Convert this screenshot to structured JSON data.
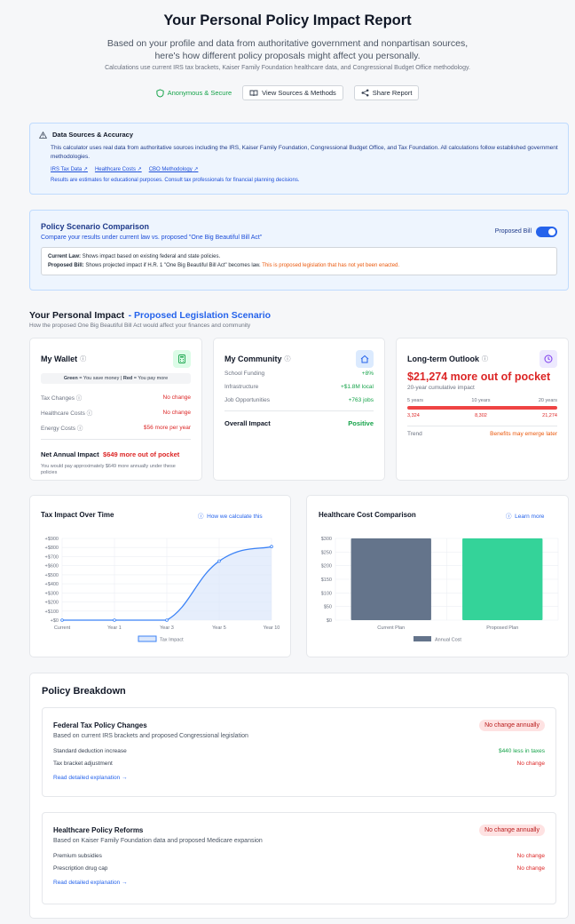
{
  "header": {
    "title": "Your Personal Policy Impact Report",
    "subtitle": "Based on your profile and data from authoritative government and nonpartisan sources, here's how different policy proposals might affect you personally.",
    "note": "Calculations use current IRS tax brackets, Kaiser Family Foundation healthcare data, and Congressional Budget Office methodology.",
    "secure_label": "Anonymous & Secure",
    "sources_button": "View Sources & Methods",
    "share_button": "Share Report"
  },
  "sources": {
    "title": "Data Sources & Accuracy",
    "body": "This calculator uses real data from authoritative sources including the IRS, Kaiser Family Foundation, Congressional Budget Office, and Tax Foundation. All calculations follow established government methodologies.",
    "links": [
      "IRS Tax Data",
      "Healthcare Costs",
      "CBO Methodology"
    ],
    "disclaimer": "Results are estimates for educational purposes. Consult tax professionals for financial planning decisions."
  },
  "scenario": {
    "title": "Policy Scenario Comparison",
    "subtitle": "Compare your results under current law vs. proposed \"One Big Beautiful Bill Act\"",
    "toggle_label": "Proposed Bill",
    "toggle_on": true,
    "current_law_label": "Current Law:",
    "current_law_text": "Shows impact based on existing federal and state policies.",
    "proposed_label": "Proposed Bill:",
    "proposed_text": "Shows projected impact if H.R. 1 \"One Big Beautiful Bill Act\" becomes law.",
    "proposed_warning": "This is proposed legislation that has not yet been enacted."
  },
  "impact": {
    "title": "Your Personal Impact",
    "title_highlight": "- Proposed Legislation Scenario",
    "subtitle": "How the proposed One Big Beautiful Bill Act would affect your finances and community"
  },
  "wallet": {
    "title": "My Wallet",
    "legend_green": "Green",
    "legend_green_text": "= You save money |",
    "legend_red": "Red",
    "legend_red_text": "= You pay more",
    "rows": [
      {
        "label": "Tax Changes",
        "value": "No change"
      },
      {
        "label": "Healthcare Costs",
        "value": "No change"
      },
      {
        "label": "Energy Costs",
        "value": "$56 more per year"
      }
    ],
    "net_label": "Net Annual Impact",
    "net_value": "$649 more out of pocket",
    "net_note": "You would pay approximately $649 more annually under these policies"
  },
  "community": {
    "title": "My Community",
    "rows": [
      {
        "label": "School Funding",
        "value": "+8%"
      },
      {
        "label": "Infrastructure",
        "value": "+$1.8M local"
      },
      {
        "label": "Job Opportunities",
        "value": "+763 jobs"
      }
    ],
    "overall_label": "Overall Impact",
    "overall_value": "Positive"
  },
  "outlook": {
    "title": "Long-term Outlook",
    "headline": "$21,274 more out of pocket",
    "sub": "20-year cumulative impact",
    "years": [
      "5 years",
      "10 years",
      "20 years"
    ],
    "values": [
      "3,324",
      "8,302",
      "21,274"
    ],
    "trend_label": "Trend",
    "trend_value": "Benefits may emerge later"
  },
  "tax_chart": {
    "title": "Tax Impact Over Time",
    "link": "How we calculate this",
    "legend": "Tax Impact"
  },
  "health_chart": {
    "title": "Healthcare Cost Comparison",
    "link": "Learn more",
    "legend": "Annual Cost"
  },
  "chart_data": [
    {
      "type": "area",
      "title": "Tax Impact Over Time",
      "x": [
        "Current",
        "Year 1",
        "Year 3",
        "Year 5",
        "Year 10"
      ],
      "series": [
        {
          "name": "Tax Impact",
          "values": [
            0,
            0,
            0,
            650,
            810
          ]
        }
      ],
      "yticks": [
        "+$0",
        "+$100",
        "+$200",
        "+$300",
        "+$400",
        "+$500",
        "+$600",
        "+$700",
        "+$800",
        "+$900"
      ],
      "ylim": [
        0,
        900
      ],
      "grid": true,
      "legend": "bottom",
      "colors": {
        "line": "#3b82f6",
        "fill": "#dbe7fb"
      }
    },
    {
      "type": "bar",
      "title": "Healthcare Cost Comparison",
      "categories": [
        "Current Plan",
        "Proposed Plan"
      ],
      "series": [
        {
          "name": "Annual Cost",
          "values": [
            300,
            300
          ]
        }
      ],
      "yticks": [
        "$0",
        "$50",
        "$100",
        "$150",
        "$200",
        "$250",
        "$300"
      ],
      "ylim": [
        0,
        300
      ],
      "grid": true,
      "legend": "bottom",
      "colors": [
        "#64748b",
        "#34d399"
      ]
    }
  ],
  "breakdown": {
    "title": "Policy Breakdown",
    "items": [
      {
        "title": "Federal Tax Policy Changes",
        "badge": "No change annually",
        "sub": "Based on current IRS brackets and proposed Congressional legislation",
        "rows": [
          {
            "label": "Standard deduction increase",
            "value": "$440 less in taxes"
          },
          {
            "label": "Tax bracket adjustment",
            "value": "No change"
          }
        ],
        "link": "Read detailed explanation →"
      },
      {
        "title": "Healthcare Policy Reforms",
        "badge": "No change annually",
        "sub": "Based on Kaiser Family Foundation data and proposed Medicare expansion",
        "rows": [
          {
            "label": "Premium subsidies",
            "value": "No change"
          },
          {
            "label": "Prescription drug cap",
            "value": "No change"
          }
        ],
        "link": "Read detailed explanation →"
      }
    ]
  }
}
